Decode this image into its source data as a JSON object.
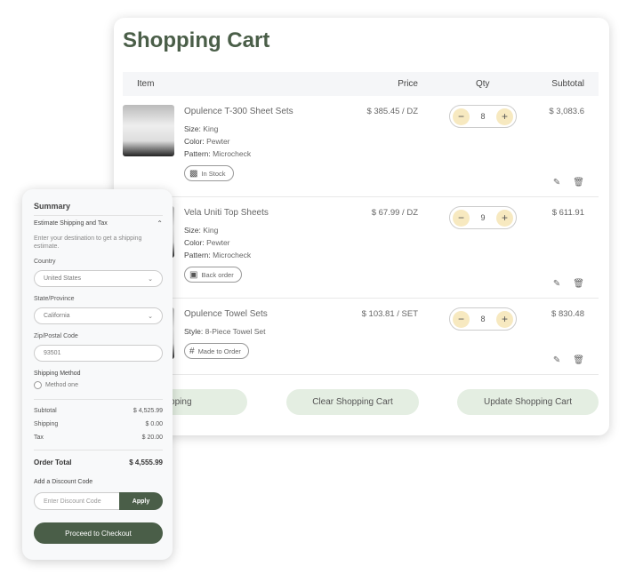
{
  "cart": {
    "title": "Shopping Cart",
    "headers": {
      "item": "Item",
      "price": "Price",
      "qty": "Qty",
      "subtotal": "Subtotal"
    },
    "items": [
      {
        "name": "Opulence T-300 Sheet Sets",
        "attrs": [
          {
            "k": "Size:",
            "v": "King"
          },
          {
            "k": "Color:",
            "v": "Pewter"
          },
          {
            "k": "Pattern:",
            "v": "Microcheck"
          }
        ],
        "badge": "In Stock",
        "badge_icon": "stock-check-icon",
        "price": "$ 385.45 / DZ",
        "qty": "8",
        "subtotal": "$ 3,083.6"
      },
      {
        "name": "Vela Uniti Top Sheets",
        "attrs": [
          {
            "k": "Size:",
            "v": "King"
          },
          {
            "k": "Color:",
            "v": "Pewter"
          },
          {
            "k": "Pattern:",
            "v": "Microcheck"
          }
        ],
        "badge": "Back order",
        "badge_icon": "box-icon",
        "price": "$ 67.99 / DZ",
        "qty": "9",
        "subtotal": "$ 611.91"
      },
      {
        "name": "Opulence Towel Sets",
        "attrs": [
          {
            "k": "Style:",
            "v": "8-Piece Towel Set"
          }
        ],
        "badge": "Made to Order",
        "badge_icon": "grid-icon",
        "price": "$ 103.81 / SET",
        "qty": "8",
        "subtotal": "$ 830.48"
      }
    ],
    "buttons": {
      "continue": "Continue Shopping",
      "clear": "Clear Shopping Cart",
      "update": "Update Shopping Cart"
    }
  },
  "summary": {
    "title": "Summary",
    "estimate": "Estimate Shipping and Tax",
    "hint": "Enter your destination to get a shipping estimate.",
    "country_label": "Country",
    "country": "United States",
    "state_label": "State/Province",
    "state": "California",
    "zip_label": "Zip/Postal Code",
    "zip": "93501",
    "method_label": "Shipping Method",
    "method": "Method one",
    "subtotal_label": "Subtotal",
    "subtotal": "$ 4,525.99",
    "shipping_label": "Shipping",
    "shipping": "$ 0.00",
    "tax_label": "Tax",
    "tax": "$ 20.00",
    "total_label": "Order Total",
    "total": "$ 4,555.99",
    "discount_label": "Add a Discount Code",
    "discount_placeholder": "Enter Discount Code",
    "apply": "Apply",
    "checkout": "Proceed to Checkout"
  },
  "colors": {
    "accent": "#4a5e48",
    "qty_button": "#f7e9c0",
    "secondary_button": "#e4eee2"
  }
}
